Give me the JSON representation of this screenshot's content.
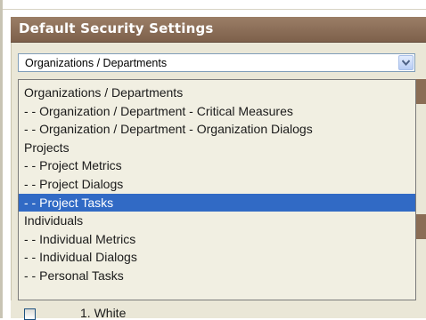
{
  "panel": {
    "title": "Default Security Settings"
  },
  "select": {
    "value": "Organizations / Departments"
  },
  "dropdown": {
    "options": [
      "Organizations / Departments",
      "- - Organization / Department - Critical Measures",
      "- - Organization / Department - Organization Dialogs",
      "Projects",
      "- - Project Metrics",
      "- - Project Dialogs",
      "- - Project Tasks",
      "Individuals",
      "- - Individual Metrics",
      "- - Individual Dialogs",
      "- - Personal Tasks"
    ],
    "selected_option": "- - Project Tasks"
  },
  "behind": {
    "list_item_text": "1. White"
  },
  "colors": {
    "header_brown": "#8b6e58",
    "panel_bg": "#eae7d7",
    "selection_blue": "#316ac5",
    "select_border": "#7f9db9"
  },
  "icons": {
    "select_arrow": "chevron-down-icon"
  }
}
